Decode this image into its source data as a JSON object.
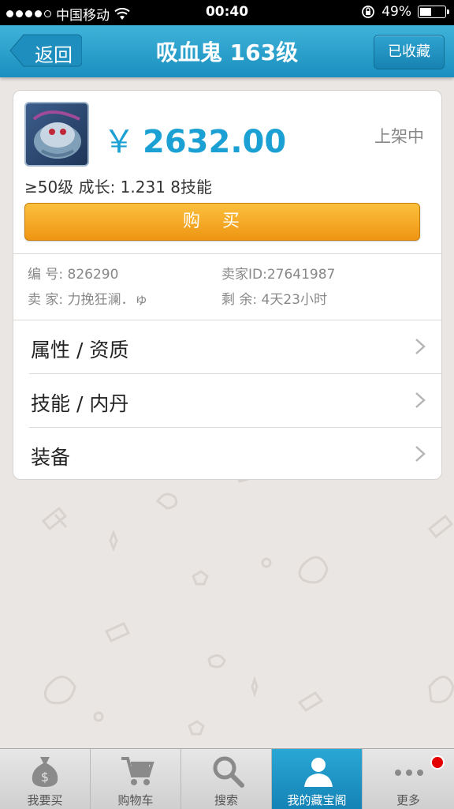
{
  "status_bar": {
    "carrier": "中国移动",
    "time": "00:40",
    "battery": "49%"
  },
  "nav": {
    "back_label": "返回",
    "title": "吸血鬼 163级",
    "favorite_label": "已收藏"
  },
  "listing": {
    "currency_symbol": "￥",
    "price": "2632.00",
    "status": "上架中",
    "summary": "≥50级 成长: 1.231  8技能",
    "buy_label": "购买",
    "info": {
      "id_label": "编  号:",
      "id_value": "826290",
      "seller_id_label": "卖家ID:",
      "seller_id_value": "27641987",
      "seller_label": "卖  家:",
      "seller_value": "力挽狂澜．ゅ",
      "remaining_label": "剩  余:",
      "remaining_value": "4天23小时"
    }
  },
  "menu": [
    {
      "label": "属性 / 资质"
    },
    {
      "label": "技能 / 内丹"
    },
    {
      "label": "装备"
    }
  ],
  "tabs": [
    {
      "label": "我要买",
      "icon": "money-bag-icon"
    },
    {
      "label": "购物车",
      "icon": "cart-icon"
    },
    {
      "label": "搜索",
      "icon": "search-icon"
    },
    {
      "label": "我的藏宝阁",
      "icon": "person-icon",
      "active": true
    },
    {
      "label": "更多",
      "icon": "more-icon",
      "badge": true
    }
  ],
  "colors": {
    "accent": "#1aa0d3",
    "buy_button": "#f2a21f",
    "background": "#eae6e3"
  }
}
